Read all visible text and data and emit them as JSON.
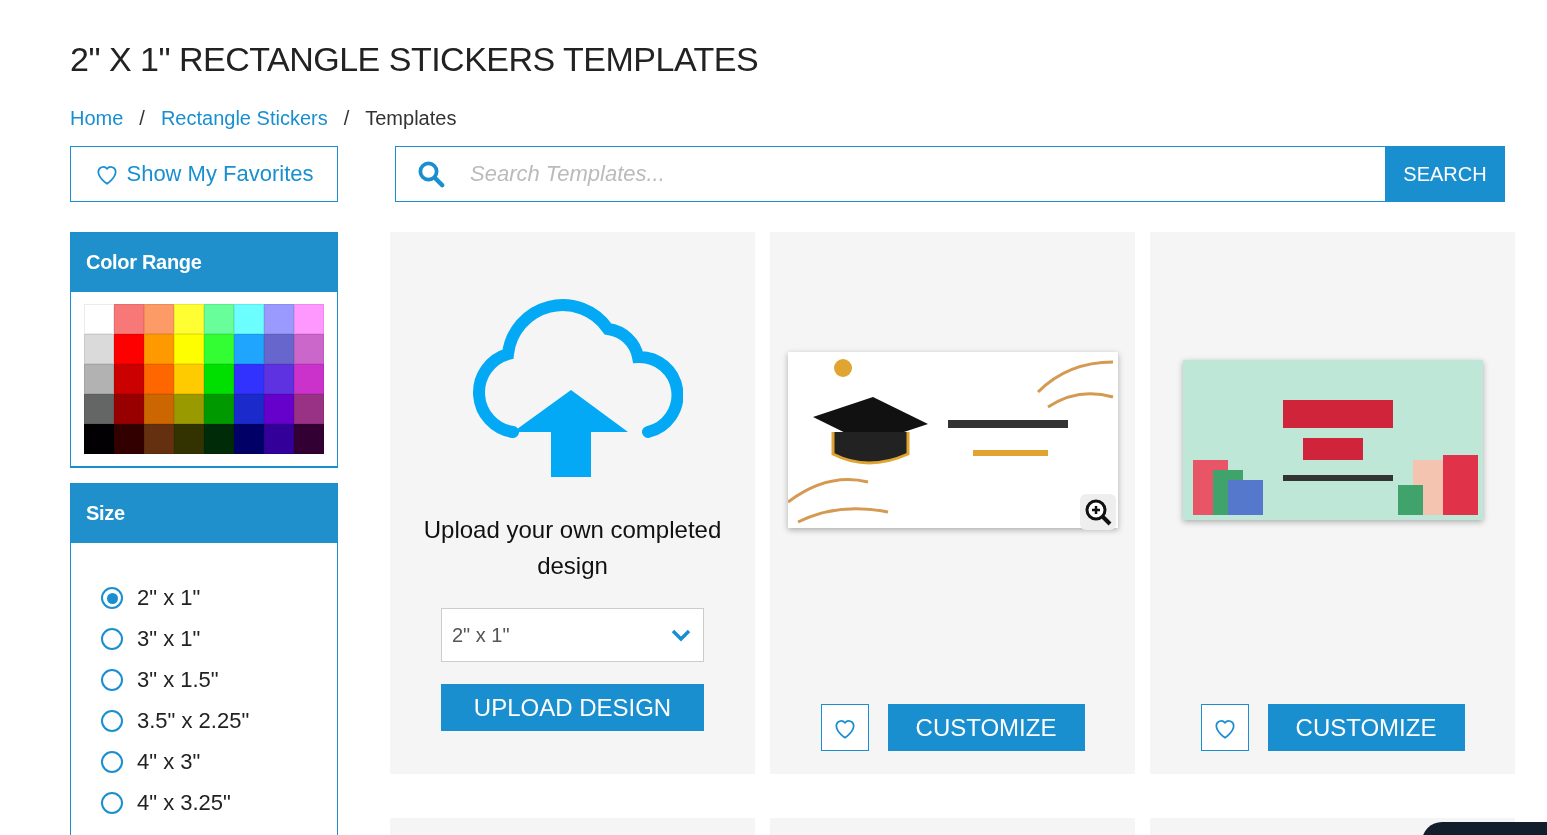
{
  "title": "2\" X 1\" RECTANGLE STICKERS TEMPLATES",
  "breadcrumb": [
    {
      "label": "Home",
      "link": true
    },
    {
      "label": "Rectangle Stickers",
      "link": true
    },
    {
      "label": "Templates",
      "link": false
    }
  ],
  "breadcrumb_separator": "/",
  "favorites_button": "Show My Favorites",
  "search": {
    "placeholder": "Search Templates...",
    "button": "SEARCH"
  },
  "color_range": {
    "heading": "Color Range",
    "swatches": [
      {
        "color": "#ffffff"
      },
      {
        "color": "#f87878"
      },
      {
        "color": "#fe9a66"
      },
      {
        "color": "#fefe33"
      },
      {
        "color": "#68fe9a"
      },
      {
        "color": "#6cfefe"
      },
      {
        "color": "#9a9afe"
      },
      {
        "color": "#fe98fe"
      },
      {
        "color": "#dadada"
      },
      {
        "color": "#fe0000"
      },
      {
        "color": "#fe9900"
      },
      {
        "color": "#fefe00"
      },
      {
        "color": "#33fe33"
      },
      {
        "color": "#1fa5fe"
      },
      {
        "color": "#6666cc"
      },
      {
        "color": "#cb66cb"
      },
      {
        "color": "#b2b2b2"
      },
      {
        "color": "#cb0000"
      },
      {
        "color": "#fe6600"
      },
      {
        "color": "#fecb00"
      },
      {
        "color": "#00e000"
      },
      {
        "color": "#3232fe"
      },
      {
        "color": "#5e32e0"
      },
      {
        "color": "#cb32cb"
      },
      {
        "color": "#646666"
      },
      {
        "color": "#980000"
      },
      {
        "color": "#cb6600"
      },
      {
        "color": "#999900"
      },
      {
        "color": "#009900"
      },
      {
        "color": "#1a2acb"
      },
      {
        "color": "#6600cb"
      },
      {
        "color": "#993185"
      },
      {
        "color": "#020002"
      },
      {
        "color": "#330000"
      },
      {
        "color": "#643010"
      },
      {
        "color": "#323300"
      },
      {
        "color": "#002b08"
      },
      {
        "color": "#000066"
      },
      {
        "color": "#330099"
      },
      {
        "color": "#320032"
      }
    ]
  },
  "size": {
    "heading": "Size",
    "options": [
      {
        "label": "2\" x 1\"",
        "selected": true
      },
      {
        "label": "3\" x 1\"",
        "selected": false
      },
      {
        "label": "3\" x 1.5\"",
        "selected": false
      },
      {
        "label": "3.5\" x 2.25\"",
        "selected": false
      },
      {
        "label": "4\" x 3\"",
        "selected": false
      },
      {
        "label": "4\" x 3.25\"",
        "selected": false
      }
    ]
  },
  "upload_card": {
    "text": "Upload your own completed design",
    "size_value": "2\" x 1\"",
    "button": "UPLOAD DESIGN"
  },
  "templates": [
    {
      "kind": "graduation",
      "button": "CUSTOMIZE",
      "zoom": true
    },
    {
      "kind": "thankyou",
      "button": "CUSTOMIZE",
      "zoom": false
    }
  ]
}
